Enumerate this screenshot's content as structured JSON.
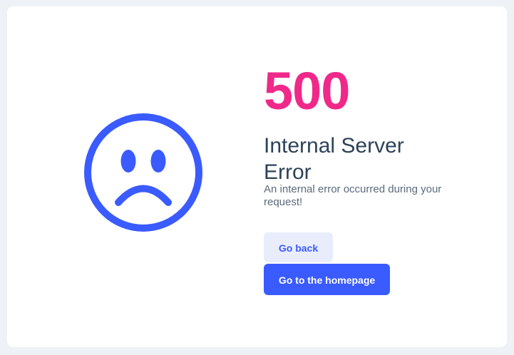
{
  "error": {
    "code": "500",
    "title": "Internal Server Error",
    "description": "An internal error occurred during your request!",
    "icon": "sad-face-icon"
  },
  "actions": {
    "back_label": "Go back",
    "home_label": "Go to the homepage"
  },
  "colors": {
    "accent": "#3a5bff",
    "code": "#f0288a",
    "title": "#2e4258",
    "back_bg": "#e9edfb"
  }
}
